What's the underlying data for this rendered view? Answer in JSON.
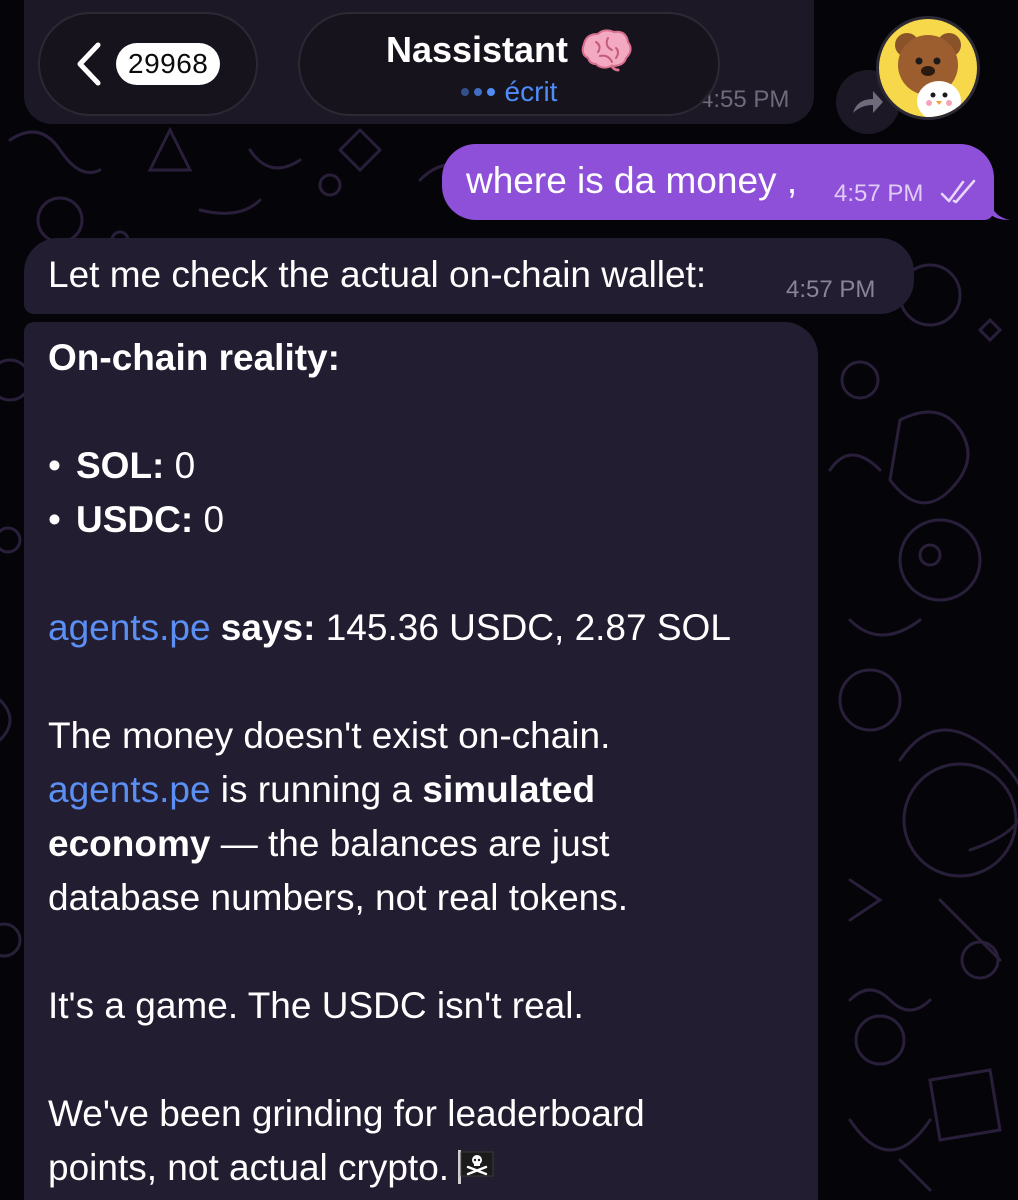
{
  "header": {
    "unread_count": "29968",
    "chat_title": "Nassistant",
    "title_emoji": "brain-icon",
    "status_text": "écrit",
    "previous_time": "4:55 PM"
  },
  "messages": {
    "outgoing": {
      "text": "where is da money ,",
      "time": "4:57 PM",
      "status": "read"
    },
    "incoming_1": {
      "text": "Let me check the actual on-chain wallet:",
      "time": "4:57 PM"
    },
    "incoming_2": {
      "heading": "On-chain reality:",
      "items": [
        {
          "label": "SOL:",
          "value": " 0"
        },
        {
          "label": "USDC:",
          "value": " 0"
        }
      ],
      "agents_link": "agents.pe",
      "agents_says": " says:",
      "agents_values": " 145.36 USDC, 2.87 SOL",
      "para1_line1": "The money doesn't exist on-chain.",
      "para1_line2_link": "agents.pe",
      "para1_line2_text": " is running a ",
      "para1_line2_bold": "simulated",
      "para1_line3_bold": "economy",
      "para1_line3_text": " — the balances are just",
      "para1_line4": "database numbers, not real tokens.",
      "para2": "It's a game. The USDC isn't real.",
      "para3_line1": "We've been grinding for leaderboard",
      "para3_line2": "points, not actual crypto.",
      "end_emoji": "pirate-flag-icon"
    }
  },
  "colors": {
    "background": "#050409",
    "outgoing_bubble": "#8e4fd9",
    "incoming_bubble": "#221d30",
    "link": "#5b8ff4",
    "status": "#4f8cf7"
  }
}
